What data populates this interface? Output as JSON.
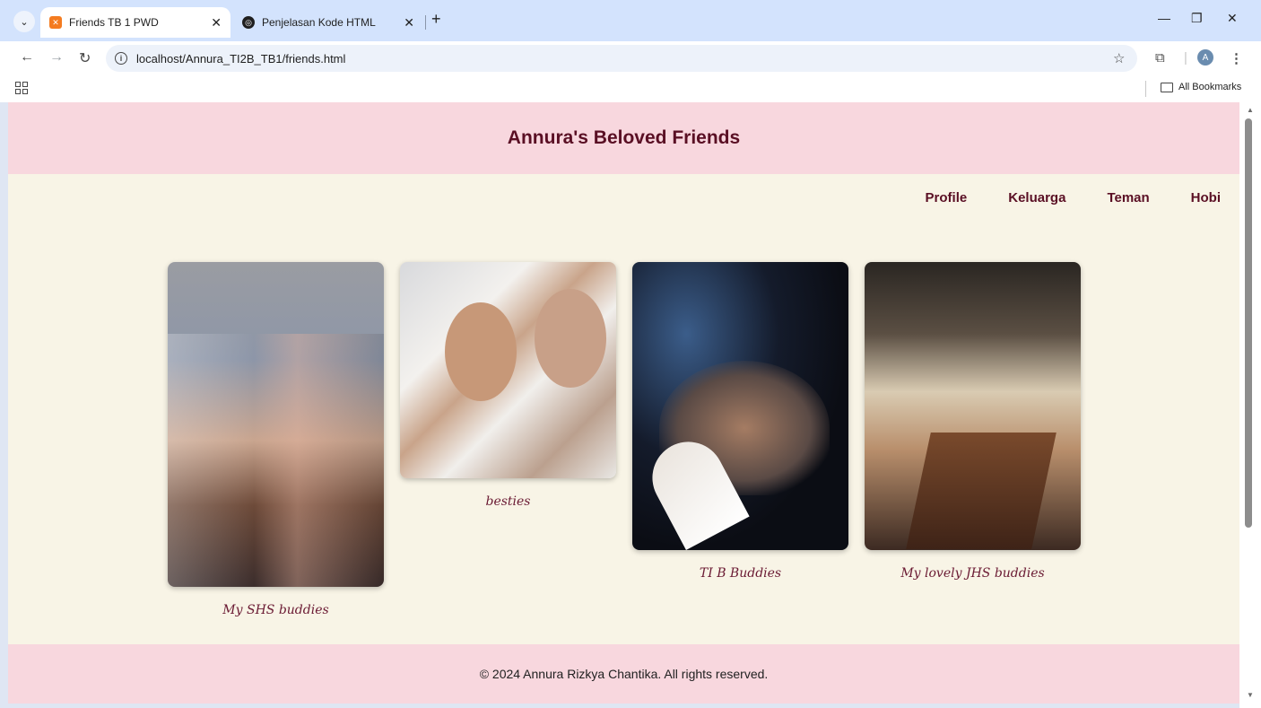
{
  "browser": {
    "tabs": [
      {
        "title": "Friends TB 1 PWD",
        "favicon": "xampp-icon",
        "active": true
      },
      {
        "title": "Penjelasan Kode HTML",
        "favicon": "openai-icon",
        "active": false
      }
    ],
    "close_glyph": "✕",
    "new_tab_glyph": "+",
    "url": "localhost/Annura_TI2B_TB1/friends.html",
    "profile_initial": "A",
    "bookmarks_label": "All Bookmarks"
  },
  "page": {
    "title": "Annura's Beloved Friends",
    "nav": [
      "Profile",
      "Keluarga",
      "Teman",
      "Hobi"
    ],
    "gallery": [
      {
        "caption": "My SHS buddies"
      },
      {
        "caption": "besties"
      },
      {
        "caption": "TI B Buddies"
      },
      {
        "caption": "My lovely JHS buddies"
      }
    ],
    "footer": "© 2024 Annura Rizkya Chantika. All rights reserved."
  },
  "colors": {
    "header_bg": "#f8d7de",
    "page_bg": "#f8f4e6",
    "accent_text": "#5a0f24",
    "tab_strip": "#d3e3fd"
  }
}
